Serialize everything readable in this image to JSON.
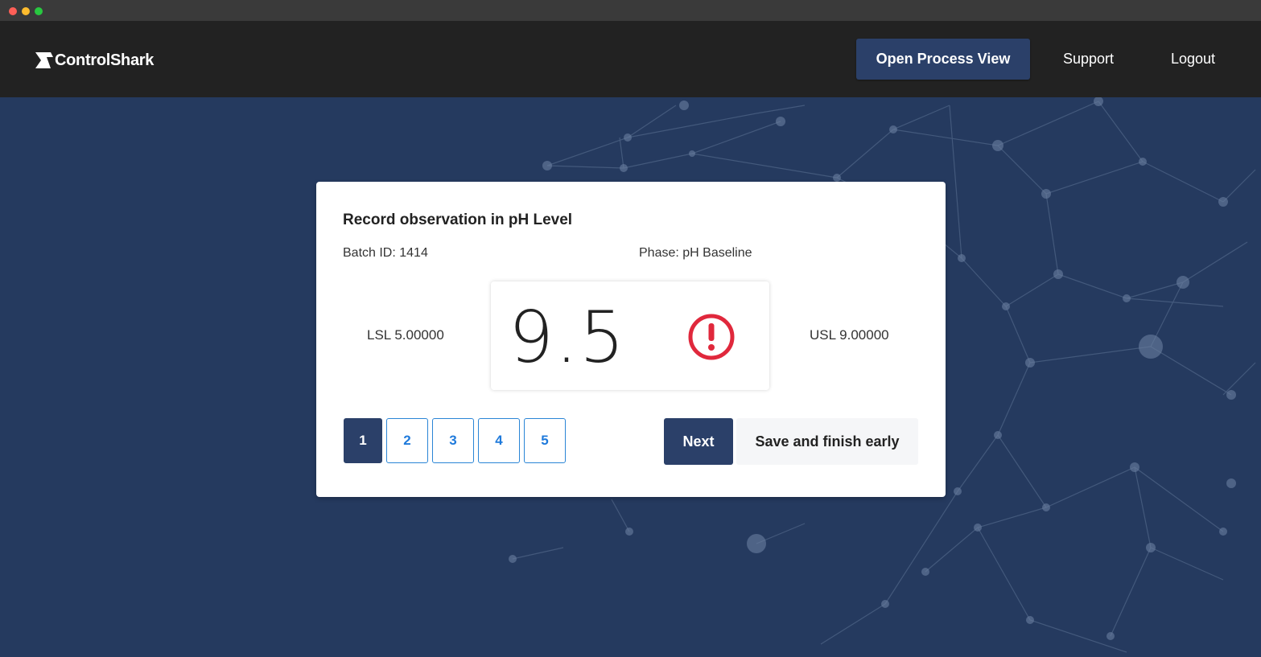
{
  "window": {
    "controls": [
      "close",
      "minimize",
      "zoom"
    ],
    "colors": {
      "close": "#ff5f57",
      "minimize": "#febc2e",
      "zoom": "#28c840"
    }
  },
  "navbar": {
    "brand": "ControlShark",
    "logo_icon": "shark-fin-icon",
    "open_process_view": "Open Process View",
    "support": "Support",
    "logout": "Logout"
  },
  "card": {
    "title": "Record observation in pH Level",
    "batch": "Batch ID: 1414",
    "phase": "Phase: pH Baseline",
    "lsl": "LSL 5.00000",
    "usl": "USL 9.00000",
    "reading": "9.5",
    "status_icon": "alert-exclamation-icon",
    "status_color": "#e0283c",
    "pages": [
      "1",
      "2",
      "3",
      "4",
      "5"
    ],
    "active_page": "1",
    "next_label": "Next",
    "save_label": "Save and finish early"
  },
  "colors": {
    "accent": "#2b4069",
    "background": "#253a5f",
    "navbar": "#222222",
    "link": "#1f7adb"
  }
}
